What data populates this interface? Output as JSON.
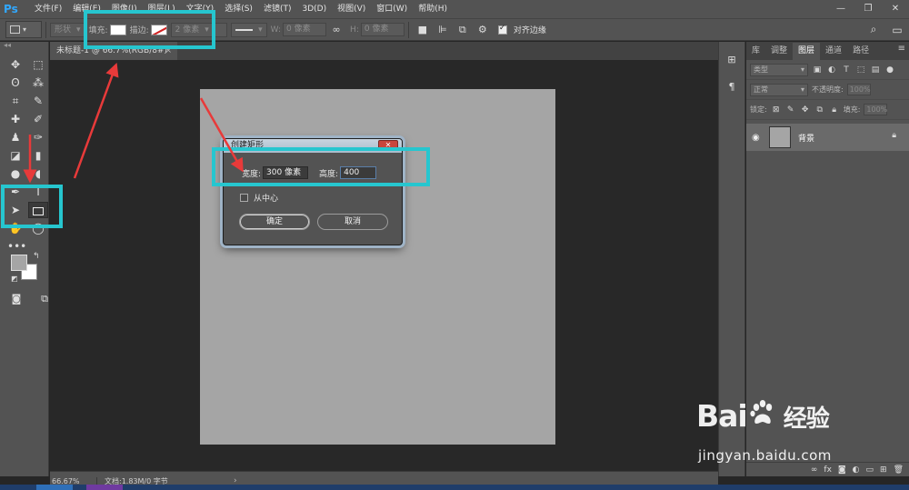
{
  "app": {
    "logo": "Ps",
    "menu": [
      "文件(F)",
      "编辑(E)",
      "图像(I)",
      "图层(L)",
      "文字(Y)",
      "选择(S)",
      "滤镜(T)",
      "3D(D)",
      "视图(V)",
      "窗口(W)",
      "帮助(H)"
    ],
    "window_controls": {
      "minimize": "—",
      "restore": "❐",
      "close": "✕"
    }
  },
  "options": {
    "mode": "形状",
    "fill_label": "填充:",
    "stroke_label": "描边:",
    "stroke_width": "2 像素",
    "w_label": "W:",
    "w_value": "0 像素",
    "h_label": "H:",
    "h_value": "0 像素",
    "align_edges": "对齐边缘"
  },
  "document": {
    "tab_title": "未标题-1 @ 66.7%(RGB/8#)",
    "tab_close": "×",
    "zoom": "66.67%",
    "doc_info": "文档:1.83M/0 字节",
    "status_arrow": "›"
  },
  "dialog": {
    "title": "创建矩形",
    "close": "✕",
    "width_label": "宽度:",
    "width_value": "300 像素",
    "height_label": "高度:",
    "height_value": "400",
    "from_center": "从中心",
    "ok": "确定",
    "cancel": "取消"
  },
  "panel": {
    "tabs": [
      "库",
      "调整",
      "图层",
      "通道",
      "路径"
    ],
    "active_tab": "图层",
    "filter_kind": "类型",
    "blend_mode": "正常",
    "opacity_label": "不透明度:",
    "opacity_value": "100%",
    "lock_label": "锁定:",
    "fill_label": "填充:",
    "fill_value": "100%",
    "layers": [
      {
        "name": "背景",
        "locked": true,
        "visible": true
      }
    ]
  },
  "watermark": {
    "brand_a": "Bai",
    "brand_b": "经验",
    "url": "jingyan.baidu.com"
  },
  "colors": {
    "highlight": "#26c6cf",
    "arrow": "#e83a3a",
    "canvas": "#a5a5a5"
  }
}
